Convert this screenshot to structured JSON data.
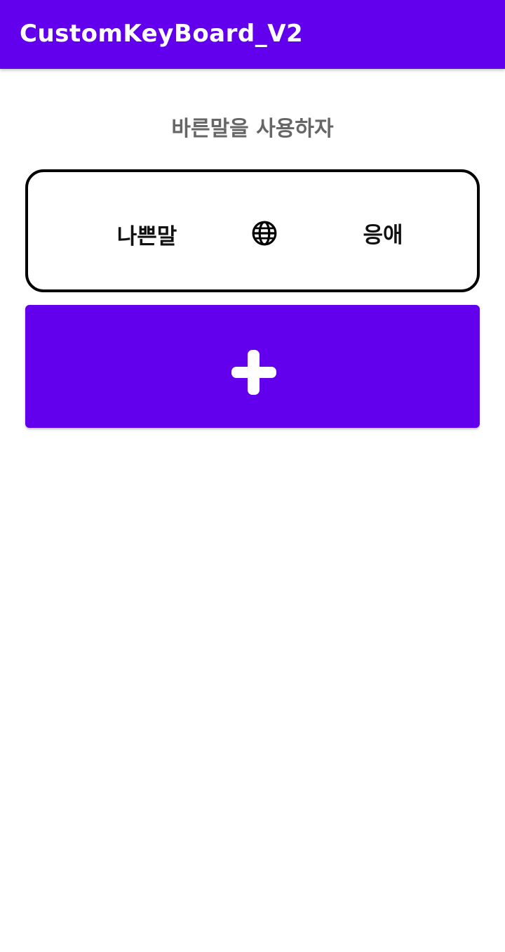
{
  "app_bar": {
    "title": "CustomKeyBoard_V2",
    "background": "#6200EE"
  },
  "main": {
    "subtitle": "바른말을 사용하자",
    "word_pair": {
      "bad_word": "나쁜말",
      "translate_icon": "globe-icon",
      "good_word": "응애"
    },
    "add_button": {
      "icon": "plus-icon",
      "color": "#6200EE"
    }
  }
}
